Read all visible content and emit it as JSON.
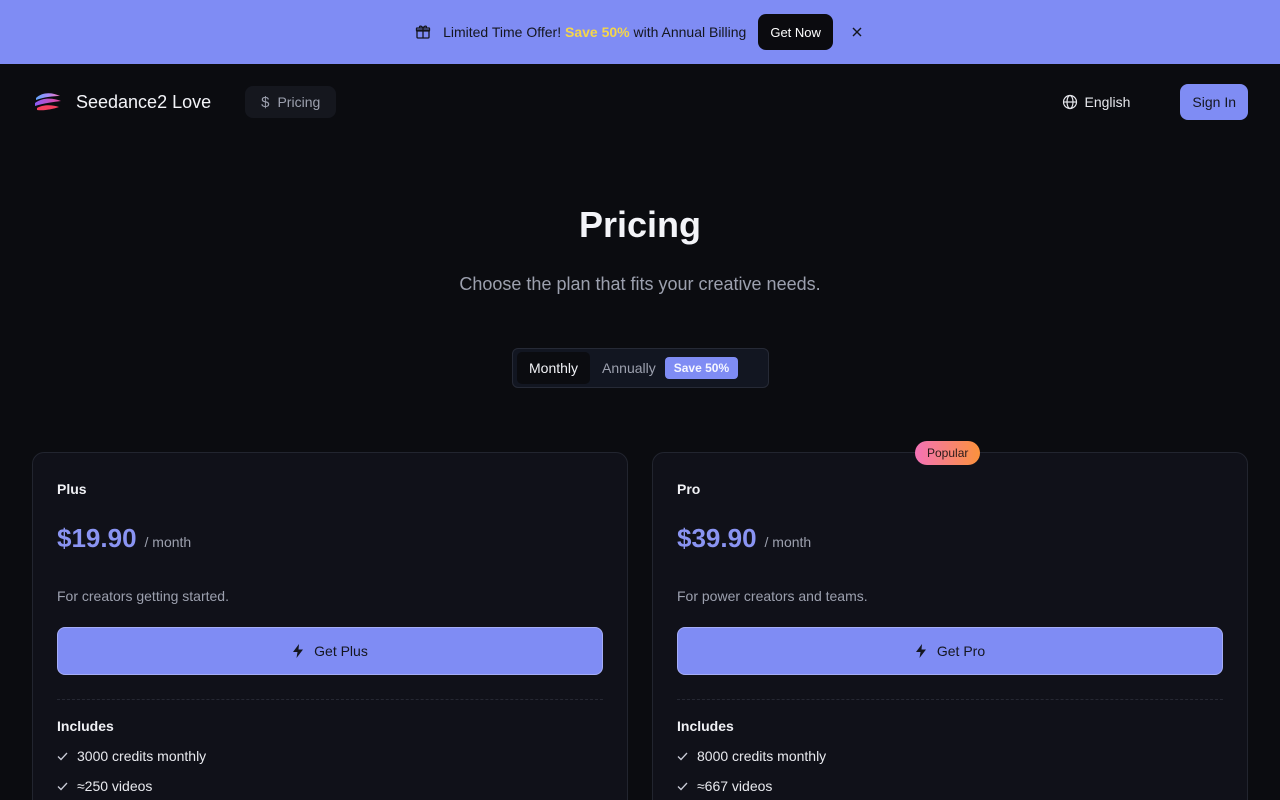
{
  "promo": {
    "prefix": "Limited Time Offer!",
    "highlight": "Save 50%",
    "suffix": "with Annual Billing",
    "button": "Get Now"
  },
  "header": {
    "brand": "Seedance2 Love",
    "nav_pricing": "Pricing",
    "language": "English",
    "signin": "Sign In"
  },
  "hero": {
    "title": "Pricing",
    "subtitle": "Choose the plan that fits your creative needs."
  },
  "billing": {
    "monthly": "Monthly",
    "annually": "Annually",
    "save_badge": "Save 50%",
    "selected": "Monthly"
  },
  "plans": [
    {
      "name": "Plus",
      "price": "$19.90",
      "period": "/ month",
      "description": "For creators getting started.",
      "cta": "Get Plus",
      "includes_label": "Includes",
      "features": [
        "3000 credits monthly",
        "≈250 videos"
      ]
    },
    {
      "name": "Pro",
      "price": "$39.90",
      "period": "/ month",
      "description": "For power creators and teams.",
      "cta": "Get Pro",
      "includes_label": "Includes",
      "features": [
        "8000 credits monthly",
        "≈667 videos"
      ],
      "badge": "Popular"
    }
  ],
  "colors": {
    "accent": "#7f8cf4",
    "highlight": "#f5d64a",
    "background": "#0b0c10"
  }
}
